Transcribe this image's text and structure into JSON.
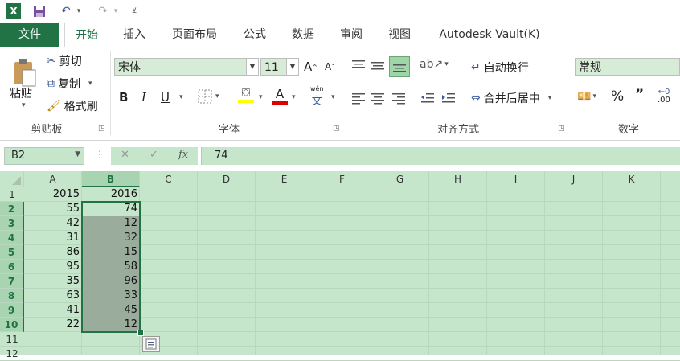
{
  "qat": {
    "excel_logo": "X",
    "icons": [
      "excel-logo-icon",
      "save-icon",
      "undo-icon",
      "redo-icon",
      "customize-icon"
    ]
  },
  "tabs": [
    "文件",
    "开始",
    "插入",
    "页面布局",
    "公式",
    "数据",
    "审阅",
    "视图",
    "Autodesk Vault(K)"
  ],
  "clipboard": {
    "paste": "粘贴",
    "cut": "剪切",
    "copy": "复制",
    "format_painter": "格式刷",
    "label": "剪贴板"
  },
  "font": {
    "name": "宋体",
    "size": "11",
    "bold": "B",
    "italic": "I",
    "underline": "U",
    "font_color": "A",
    "wen": "wén",
    "wen_char": "文",
    "label": "字体",
    "grow": "A",
    "shrink": "A"
  },
  "alignment": {
    "wrap": "自动换行",
    "merge": "合并后居中",
    "label": "对齐方式"
  },
  "number": {
    "format": "常规",
    "percent": "%",
    "comma": "”",
    "label": "数字",
    "dec": ".00"
  },
  "formula_bar": {
    "name_box": "B2",
    "fx": "fx",
    "value": "74",
    "cancel": "✕",
    "confirm": "✓"
  },
  "columns": [
    "A",
    "B",
    "C",
    "D",
    "E",
    "F",
    "G",
    "H",
    "I",
    "J",
    "K"
  ],
  "rows": [
    "1",
    "2",
    "3",
    "4",
    "5",
    "6",
    "7",
    "8",
    "9",
    "10",
    "11",
    "12"
  ],
  "cells": {
    "A": [
      "2015",
      "55",
      "42",
      "31",
      "86",
      "95",
      "35",
      "63",
      "41",
      "22"
    ],
    "B": [
      "2016",
      "74",
      "12",
      "32",
      "15",
      "58",
      "96",
      "33",
      "45",
      "12"
    ]
  },
  "colors": {
    "excel_green": "#217346",
    "grid_bg": "#c6e6cc",
    "selection": "#9aad9d"
  }
}
